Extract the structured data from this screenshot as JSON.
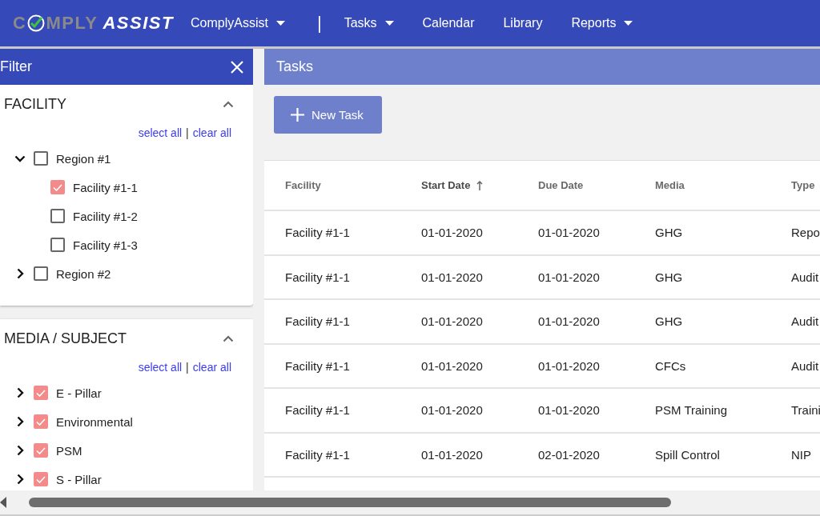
{
  "logo": {
    "left": "C",
    "middle": "MPLY",
    "right": "ASSIST"
  },
  "nav": [
    {
      "label": "ComplyAssist",
      "has_menu": true,
      "kind": "link"
    },
    {
      "kind": "divider",
      "label": "|"
    },
    {
      "label": "Tasks",
      "has_menu": true,
      "kind": "link"
    },
    {
      "label": "Calendar",
      "has_menu": false,
      "kind": "link"
    },
    {
      "label": "Library",
      "has_menu": false,
      "kind": "link"
    },
    {
      "label": "Reports",
      "has_menu": true,
      "kind": "link"
    }
  ],
  "filter": {
    "title": "Filter",
    "sections": [
      {
        "title": "FACILITY",
        "expanded": true,
        "select_all": "select all",
        "separator": "|",
        "clear_all": "clear all",
        "items": [
          {
            "label": "Region #1",
            "checked": false,
            "expanded": true,
            "children": [
              {
                "label": "Facility #1-1",
                "checked": true
              },
              {
                "label": "Facility #1-2",
                "checked": false
              },
              {
                "label": "Facility #1-3",
                "checked": false
              }
            ]
          },
          {
            "label": "Region #2",
            "checked": false,
            "expanded": false
          }
        ]
      },
      {
        "title": "MEDIA / SUBJECT",
        "expanded": true,
        "select_all": "select all",
        "separator": "|",
        "clear_all": "clear all",
        "items": [
          {
            "label": "E - Pillar",
            "checked": true,
            "expanded": false
          },
          {
            "label": "Environmental",
            "checked": true,
            "expanded": false
          },
          {
            "label": "PSM",
            "checked": true,
            "expanded": false
          },
          {
            "label": "S - Pillar",
            "checked": true,
            "expanded": false
          }
        ]
      }
    ]
  },
  "tasks": {
    "title": "Tasks",
    "new_button": "New Task",
    "columns": [
      {
        "label": "Facility",
        "sorted": false
      },
      {
        "label": "Start Date",
        "sorted": true
      },
      {
        "label": "Due Date",
        "sorted": false
      },
      {
        "label": "Media",
        "sorted": false
      },
      {
        "label": "Type",
        "sorted": false
      }
    ],
    "rows": [
      [
        "Facility #1-1",
        "01-01-2020",
        "01-01-2020",
        "GHG",
        "Repo"
      ],
      [
        "Facility #1-1",
        "01-01-2020",
        "01-01-2020",
        "GHG",
        "Audit"
      ],
      [
        "Facility #1-1",
        "01-01-2020",
        "01-01-2020",
        "GHG",
        "Audit"
      ],
      [
        "Facility #1-1",
        "01-01-2020",
        "01-01-2020",
        "CFCs",
        "Audit"
      ],
      [
        "Facility #1-1",
        "01-01-2020",
        "01-01-2020",
        "PSM Training",
        "Traini"
      ],
      [
        "Facility #1-1",
        "01-01-2020",
        "02-01-2020",
        "Spill Control",
        "NIP"
      ]
    ]
  }
}
